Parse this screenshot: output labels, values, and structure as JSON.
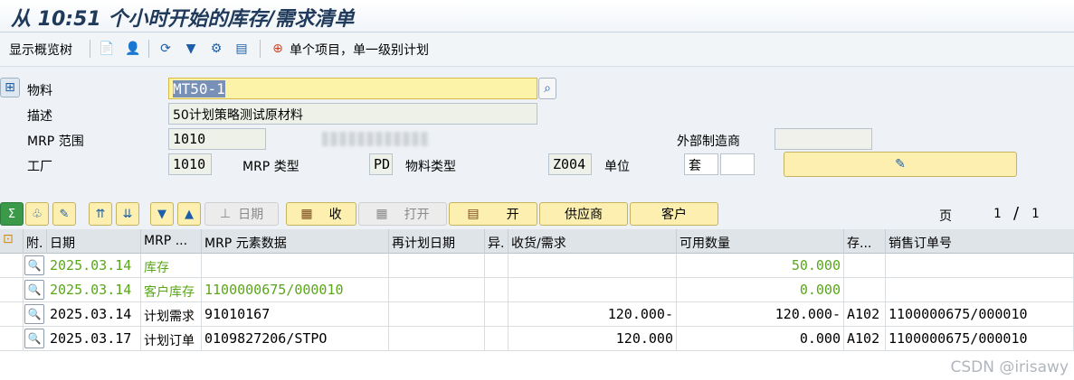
{
  "window_title": "从 10:51 个小时开始的库存/需求清单",
  "toolbar": {
    "overview_tree": "显示概览树",
    "single_item": "单个项目，单一级别计划"
  },
  "form": {
    "material_label": "物料",
    "material_value": "MT50-1",
    "desc_label": "描述",
    "desc_value": "50计划策略测试原材料",
    "mrp_area_label": "MRP 范围",
    "mrp_area_value": "1010",
    "ext_mfr_label": "外部制造商",
    "plant_label": "工厂",
    "plant_value": "1010",
    "mrp_type_label": "MRP 类型",
    "mrp_type_value": "PD",
    "material_type_label": "物料类型",
    "material_type_value": "Z004",
    "unit_label": "单位",
    "unit_value": "套"
  },
  "grid_toolbar": {
    "date_btn": "日期",
    "receive_btn": "收",
    "open_btn": "打开",
    "open2_btn": "开",
    "vendor_btn": "供应商",
    "customer_btn": "客户",
    "page_label": "页",
    "page_current": "1",
    "page_sep": "/",
    "page_total": "1"
  },
  "columns": [
    "附.",
    "日期",
    "MRP ...",
    "MRP 元素数据",
    "再计划日期",
    "异.",
    "收货/需求",
    "可用数量",
    "存...",
    "销售订单号"
  ],
  "rows": [
    {
      "date": "2025.03.14",
      "mrp": "库存",
      "element": "",
      "reschedule": "",
      "exc": "",
      "recv": "",
      "avail": "50.000",
      "stor": "",
      "so": "",
      "green": true
    },
    {
      "date": "2025.03.14",
      "mrp": "客户库存",
      "element": "1100000675/000010",
      "reschedule": "",
      "exc": "",
      "recv": "",
      "avail": "0.000",
      "stor": "",
      "so": "",
      "green": true
    },
    {
      "date": "2025.03.14",
      "mrp": "计划需求",
      "element": "91010167",
      "reschedule": "",
      "exc": "",
      "recv": "120.000-",
      "avail": "120.000-",
      "stor": "A102",
      "so": "1100000675/000010",
      "green": false
    },
    {
      "date": "2025.03.17",
      "mrp": "计划订单",
      "element": "0109827206/STPO",
      "reschedule": "",
      "exc": "",
      "recv": "120.000",
      "avail": "0.000",
      "stor": "A102",
      "so": "1100000675/000010",
      "green": false
    }
  ],
  "watermark": "CSDN @irisawy",
  "colors": {
    "green_text": "#5aa61a",
    "edit_field": "#fdf3a8",
    "button": "#fcefb0"
  }
}
